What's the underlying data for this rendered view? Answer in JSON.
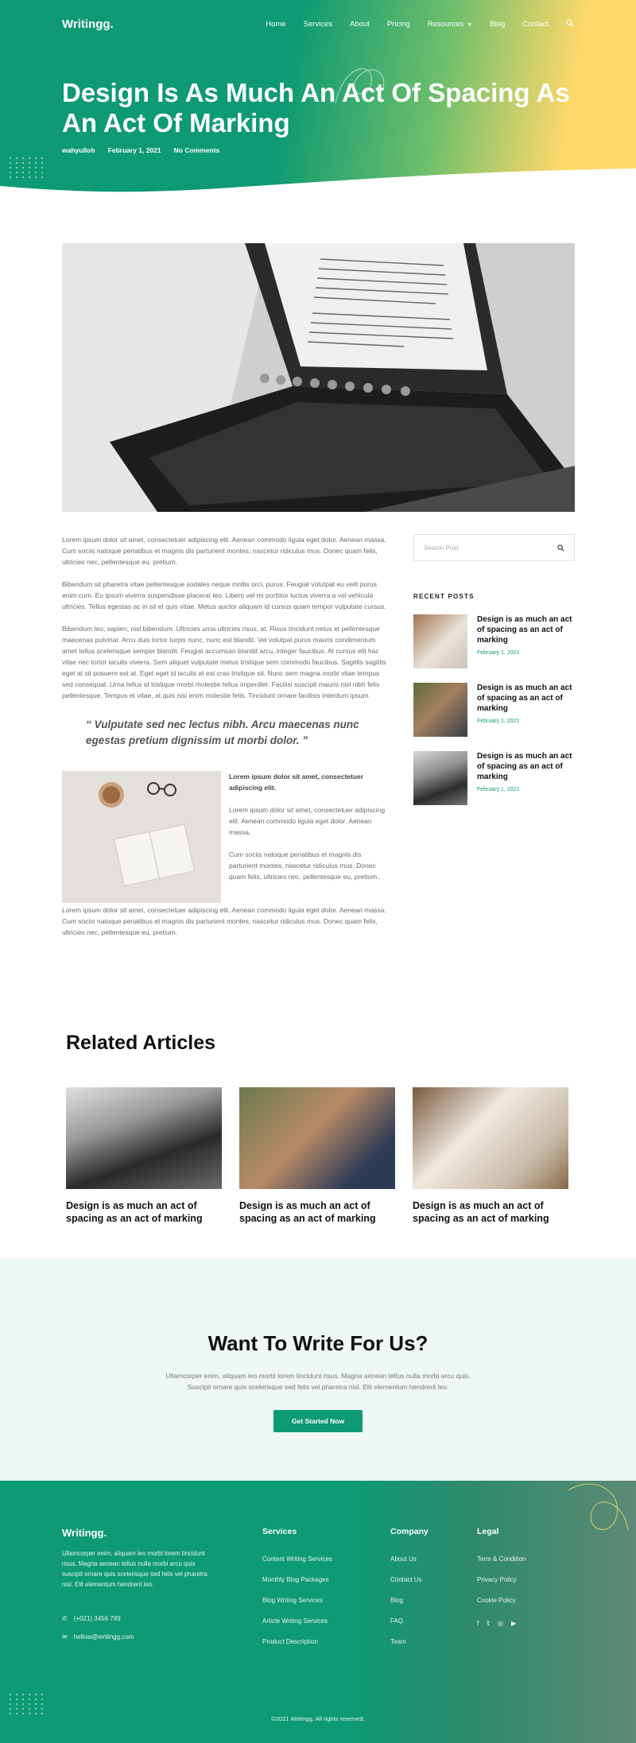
{
  "brand": {
    "name": "Writingg."
  },
  "nav": {
    "items": [
      "Home",
      "Services",
      "About",
      "Pricing",
      "Resources",
      "Blog",
      "Contact"
    ]
  },
  "post": {
    "title": "Design Is As Much An Act Of Spacing As An Act Of Marking",
    "author": "wahyulloh",
    "date": "February 1, 2021",
    "comments": "No Comments",
    "paragraphs": [
      "Lorem ipsum dolor sit amet, consectetuer adipiscing elit. Aenean commodo ligula eget dolor. Aenean massa. Cum sociis natoque penatibus et magnis dis parturient montes, nascetur ridiculus mus. Donec quam felis, ultricies nec, pellentesque eu, pretium.",
      "Bibendum sit pharetra vitae pellentesque sodales neque mollis orci, purus. Feugiat volutpat eu velit purus enim cum. Eu ipsum viverra suspendisse placerat leo. Libero vel mi porttitor luctus viverra a vel vehicula ultricies. Tellus egestas ac in sit et quis vitae. Metus auctor aliquam id cursus quam tempor vulputate cursus.",
      "Bibendum leo, sapien, nisl bibendum. Ultricies urna ultricies risus, at. Risus tincidunt netus et pellentesque maecenas pulvinar. Arcu duis tortor turpis nunc, nunc est blandit. Vel volutpat purus mauris condimentum amet tellus scelerisque semper blandit. Feugiat accumsan blandit arcu, integer faucibus. At cursus elit hac vitae nec tortor iaculis viverra. Sem aliquet vulputate metus tristique sem commodo faucibus. Sagittis sagittis eget at sit posuere est at. Eget eget id iaculis at est cras tristique sit. Nunc sem magna morbi vitae tempus sed consequat. Urna tellus id tristique morbi molestie tellus imperdiet. Facilisi suscipit mauris nisl nibh felis pellentesque. Tempus et vitae, at quis nisi enim molestie felis. Tincidunt ornare facilisis interdum ipsum."
    ],
    "quote": "“ Vulputate sed nec lectus nibh. Arcu maecenas nunc egestas pretium dignissim ut morbi dolor. ”",
    "media_title": "Lorem ipsum dolor sit amet, consectetuer adipiscing elit.",
    "media_p1": "Lorem ipsum dolor sit amet, consectetuer adipiscing elit. Aenean commodo ligula eget dolor. Aenean massa.",
    "media_p2": "Cum sociis natoque penatibus et magnis dis parturient montes, nascetur ridiculus mus. Donec quam felis, ultricies nec, pellentesque eu, pretium..",
    "closing": "Lorem ipsum dolor sit amet, consectetuer adipiscing elit. Aenean commodo ligula eget dolor. Aenean massa. Cum sociis natoque penatibus et magnis dis parturient montes, nascetur ridiculus mus. Donec quam felis, ultricies nec, pellentesque eu, pretium."
  },
  "sidebar": {
    "search_placeholder": "Search Post",
    "recent_title": "RECENT POSTS",
    "recent": [
      {
        "title": "Design is as much an act of spacing as an act of marking",
        "date": "February 1, 2021"
      },
      {
        "title": "Design is as much an act of spacing as an act of marking",
        "date": "February 1, 2021"
      },
      {
        "title": "Design is as much an act of spacing as an act of marking",
        "date": "February 1, 2021"
      }
    ]
  },
  "related": {
    "heading": "Related Articles",
    "items": [
      {
        "title": "Design is as much an act of spacing as an act of marking"
      },
      {
        "title": "Design is as much an act of spacing as an act of marking"
      },
      {
        "title": "Design is as much an act of spacing as an act of marking"
      }
    ]
  },
  "cta": {
    "heading": "Want To Write For Us?",
    "text": "Ullamcorper enim, aliquam leo morbi lorem tincidunt risus. Magna aenean tellus nulla morbi arcu quis. Suscipit ornare quis scelerisque sed felis vel pharetra nisl. Elit elementum hendrerit leo.",
    "button": "Get Started Now"
  },
  "footer": {
    "logo": "Writingg.",
    "description": "Ullamcorper enim, aliquam leo morbi lorem tincidunt risus. Magna aenean tellus nulla morbi arcu quis suscipit ornare quis scelerisque sed felis vel pharetra nisl. Elit elementum hendrerit leo.",
    "phone": "(+021) 3456 789",
    "email": "hellow@writingg.com",
    "services": {
      "title": "Services",
      "links": [
        "Content Writing Services",
        "Monthly Blog Packages",
        "Blog Writing Services",
        "Article Writing Services",
        "Product Description"
      ]
    },
    "company": {
      "title": "Company",
      "links": [
        "About Us",
        "Contact Us",
        "Blog",
        "FAQ",
        "Team"
      ]
    },
    "legal": {
      "title": "Legal",
      "links": [
        "Term & Condition",
        "Privacy Policy",
        "Cookie Policy"
      ]
    },
    "copyright": "©2021 Writingg. All rights reserved."
  },
  "colors": {
    "primary": "#0e9a72",
    "accent": "#ffd86a",
    "cta_bg": "#eef7f4"
  }
}
